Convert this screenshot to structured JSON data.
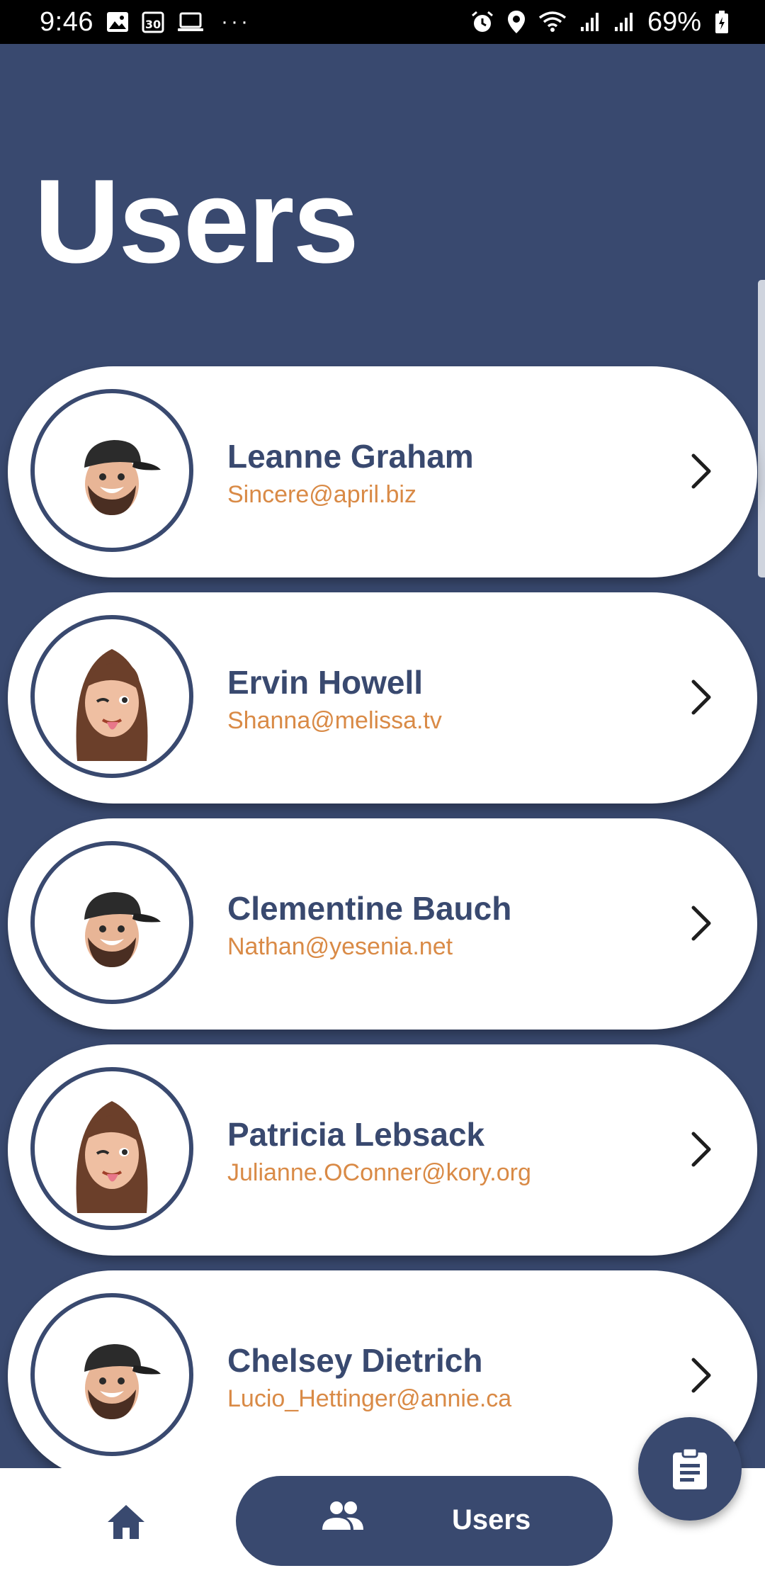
{
  "status_bar": {
    "time": "9:46",
    "battery": "69%",
    "left_icons": [
      "gallery-icon",
      "calendar-30-icon",
      "laptop-icon",
      "more-dots-icon"
    ],
    "right_icons": [
      "alarm-icon",
      "location-icon",
      "wifi-icon",
      "signal-icon",
      "signal-icon",
      "battery-icon"
    ],
    "calendar_day": "30",
    "more": "···"
  },
  "page": {
    "title": "Users"
  },
  "users": [
    {
      "name": "Leanne Graham",
      "email": "Sincere@april.biz",
      "avatar": "memoji-man-cap"
    },
    {
      "name": "Ervin Howell",
      "email": "Shanna@melissa.tv",
      "avatar": "memoji-woman-wink"
    },
    {
      "name": "Clementine Bauch",
      "email": "Nathan@yesenia.net",
      "avatar": "memoji-man-cap"
    },
    {
      "name": "Patricia Lebsack",
      "email": "Julianne.OConner@kory.org",
      "avatar": "memoji-woman-wink"
    },
    {
      "name": "Chelsey Dietrich",
      "email": "Lucio_Hettinger@annie.ca",
      "avatar": "memoji-man-cap"
    }
  ],
  "fab": {
    "icon": "clipboard-icon"
  },
  "bottom_nav": {
    "home_icon": "home-icon",
    "users_icon": "people-icon",
    "users_label": "Users",
    "active": "Users"
  },
  "colors": {
    "primary": "#39496f",
    "accent": "#d98a46",
    "card": "#ffffff"
  }
}
